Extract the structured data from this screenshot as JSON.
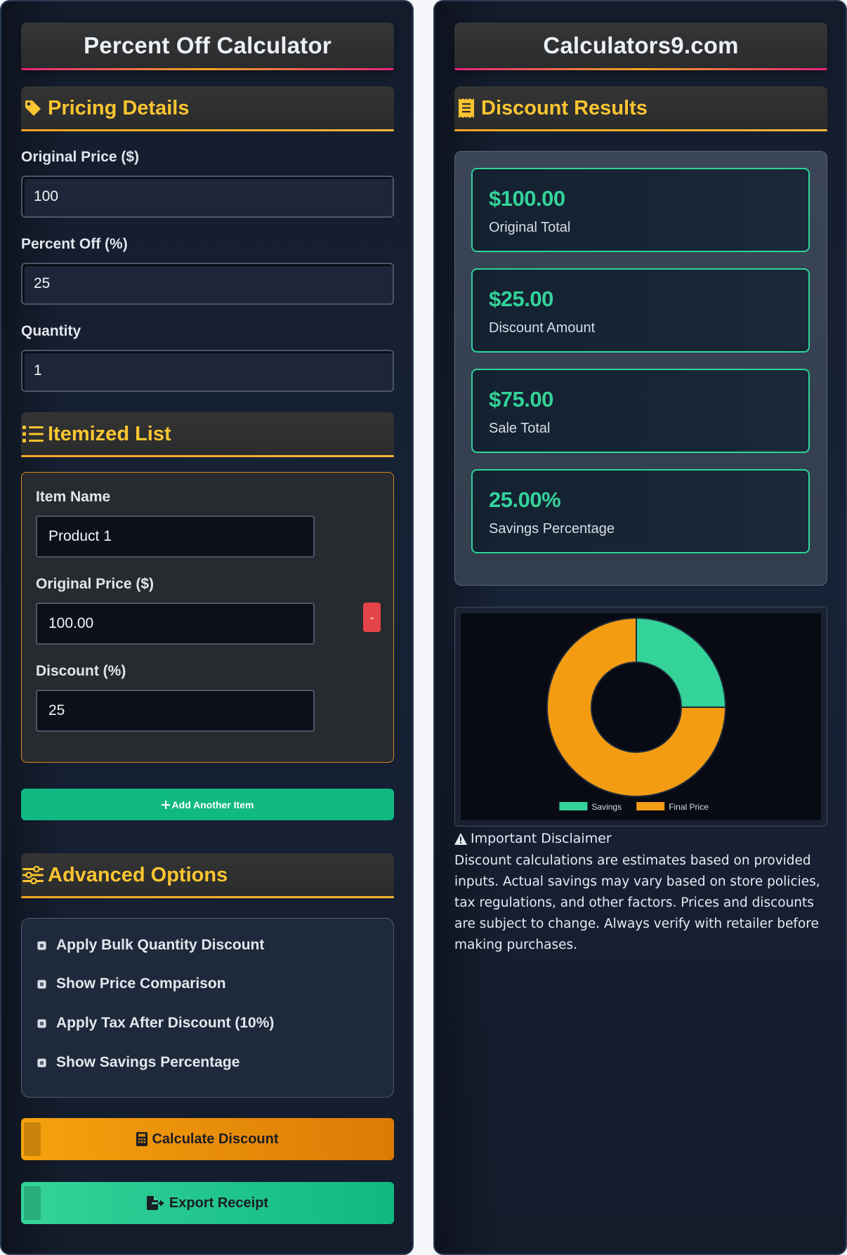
{
  "left_panel": {
    "title": "Percent Off Calculator",
    "pricing_section": {
      "heading": "Pricing Details",
      "original_price_label": "Original Price ($)",
      "original_price_value": "100",
      "percent_off_label": "Percent Off (%)",
      "percent_off_value": "25",
      "quantity_label": "Quantity",
      "quantity_value": "1"
    },
    "itemized_section": {
      "heading": "Itemized List",
      "items": [
        {
          "name_label": "Item Name",
          "name_value": "Product 1",
          "price_label": "Original Price ($)",
          "price_value": "100.00",
          "discount_label": "Discount (%)",
          "discount_value": "25",
          "remove_label": "-"
        }
      ],
      "add_button": "Add Another Item"
    },
    "advanced_section": {
      "heading": "Advanced Options",
      "options": [
        {
          "label": "Apply Bulk Quantity Discount"
        },
        {
          "label": "Show Price Comparison"
        },
        {
          "label": "Apply Tax After Discount (10%)"
        },
        {
          "label": "Show Savings Percentage"
        }
      ]
    },
    "calculate_button": "Calculate Discount",
    "export_button": "Export Receipt"
  },
  "right_panel": {
    "title": "Calculators9.com",
    "results_heading": "Discount Results",
    "results": [
      {
        "value": "$100.00",
        "label": "Original Total"
      },
      {
        "value": "$25.00",
        "label": "Discount Amount"
      },
      {
        "value": "$75.00",
        "label": "Sale Total"
      },
      {
        "value": "25.00%",
        "label": "Savings Percentage"
      }
    ],
    "disclaimer_title": "Important Disclaimer",
    "disclaimer_text": "Discount calculations are estimates based on provided inputs. Actual savings may vary based on store policies, tax regulations, and other factors. Prices and discounts are subject to change. Always verify with retailer before making purchases."
  },
  "chart_data": {
    "type": "pie",
    "labels": [
      "Savings",
      "Final Price"
    ],
    "values": [
      25,
      75
    ],
    "colors": [
      "#34d399",
      "#f39c12"
    ],
    "legend_position": "bottom",
    "title": ""
  },
  "colors": {
    "accent_yellow": "#fbc531",
    "accent_green": "#34d399",
    "accent_orange": "#f5a20e",
    "panel_bg": "#172236"
  },
  "icons": {
    "pricing": "tag-icon",
    "itemized": "list-icon",
    "advanced": "sliders-icon",
    "results": "receipt-icon",
    "calculate": "calculator-icon",
    "export": "file-export-icon",
    "add": "plus-icon",
    "disclaimer": "warning-icon"
  }
}
